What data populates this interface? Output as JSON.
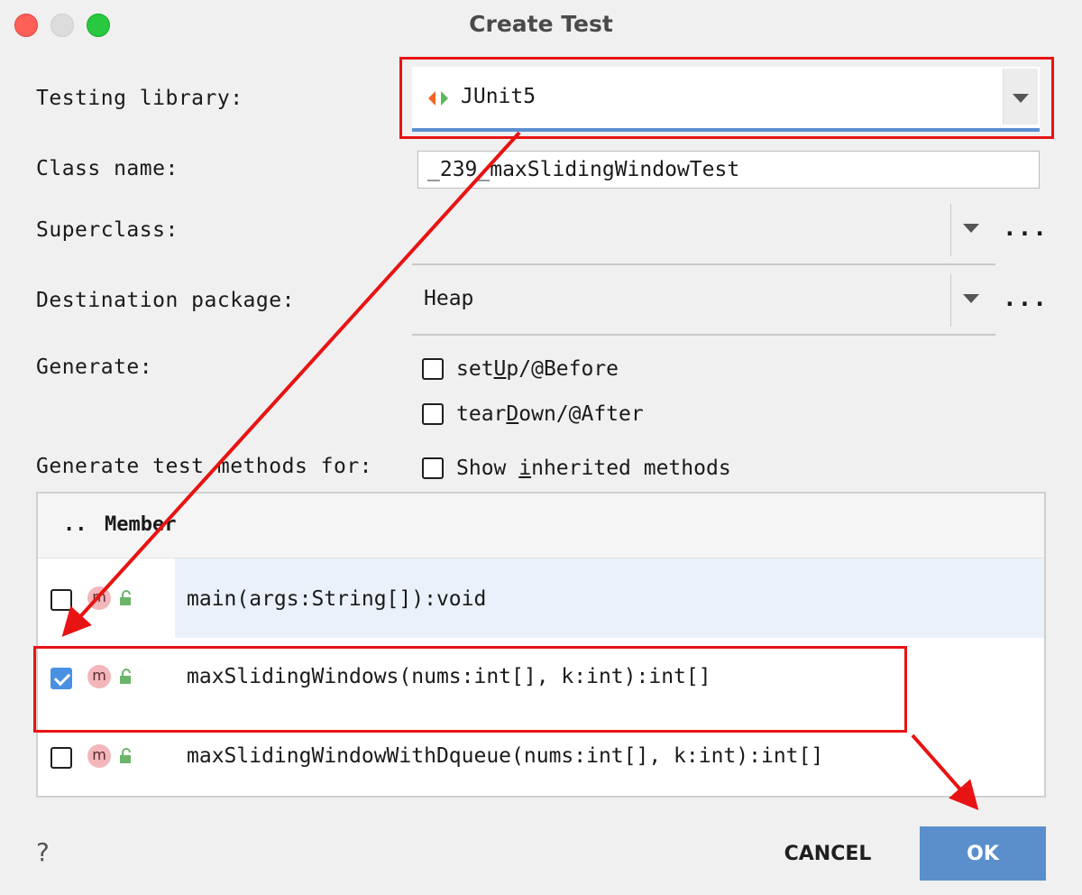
{
  "window": {
    "title": "Create Test"
  },
  "form": {
    "testing_library_label": "Testing library:",
    "testing_library_value": "JUnit5",
    "class_name_label": "Class name:",
    "class_name_value": "_239_maxSlidingWindowTest",
    "superclass_label": "Superclass:",
    "superclass_value": "",
    "destination_package_label": "Destination package:",
    "destination_package_value": "Heap",
    "ellipsis": "...",
    "generate_label": "Generate:",
    "generate_options": [
      {
        "label_pre": "set",
        "label_ul": "U",
        "label_post": "p/@Before",
        "checked": false
      },
      {
        "label_pre": "tear",
        "label_ul": "D",
        "label_post": "own/@After",
        "checked": false
      }
    ],
    "generate_methods_label": "Generate test methods for:",
    "show_inherited": {
      "label_pre": "Show ",
      "label_ul": "i",
      "label_post": "nherited methods",
      "checked": false
    }
  },
  "table": {
    "col_check": "..",
    "col_member": "Member",
    "rows": [
      {
        "icon": "m",
        "signature": "main(args:String[]):void",
        "checked": false
      },
      {
        "icon": "m",
        "signature": "maxSlidingWindows(nums:int[], k:int):int[]",
        "checked": true
      },
      {
        "icon": "m",
        "signature": "maxSlidingWindowWithDqueue(nums:int[], k:int):int[]",
        "checked": false
      }
    ]
  },
  "footer": {
    "help": "?",
    "cancel_label": "CANCEL",
    "ok_label": "OK"
  },
  "colors": {
    "annotation": "#e81313",
    "focus_underline": "#5b8fd1",
    "ok_button": "#5a8fcc",
    "checkbox_checked": "#4a90e2",
    "method_icon": "#f3b6bb"
  }
}
